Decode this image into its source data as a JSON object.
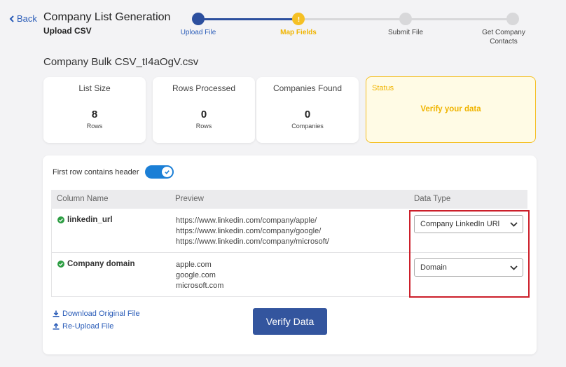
{
  "header": {
    "back_label": "Back",
    "title": "Company List Generation",
    "subtitle": "Upload CSV"
  },
  "stepper": {
    "steps": [
      {
        "label": "Upload File",
        "state": "done"
      },
      {
        "label": "Map Fields",
        "state": "current"
      },
      {
        "label": "Submit File",
        "state": "pending"
      },
      {
        "label": "Get Company Contacts",
        "state": "pending"
      }
    ],
    "colors": {
      "done": "#2c4f9e",
      "current": "#f5c024",
      "pending": "#d8d8da"
    }
  },
  "file": {
    "title": "Company Bulk CSV_tI4aOgV.csv"
  },
  "stats": [
    {
      "label": "List Size",
      "value": "8",
      "unit": "Rows"
    },
    {
      "label": "Rows Processed",
      "value": "0",
      "unit": "Rows"
    },
    {
      "label": "Companies Found",
      "value": "0",
      "unit": "Companies"
    }
  ],
  "status": {
    "label": "Status",
    "text": "Verify your data"
  },
  "mapping": {
    "header_toggle_label": "First row contains header",
    "header_toggle_on": true,
    "columns": {
      "name": "Column Name",
      "preview": "Preview",
      "type": "Data Type"
    },
    "rows": [
      {
        "name": "linkedin_url",
        "preview": [
          "https://www.linkedin.com/company/apple/",
          "https://www.linkedin.com/company/google/",
          "https://www.linkedin.com/company/microsoft/"
        ],
        "data_type": "Company LinkedIn URl"
      },
      {
        "name": "Company domain",
        "preview": [
          "apple.com",
          "google.com",
          "microsoft.com"
        ],
        "data_type": "Domain"
      }
    ]
  },
  "actions": {
    "download_label": "Download Original File",
    "reupload_label": "Re-Upload File",
    "verify_label": "Verify Data"
  },
  "colors": {
    "accent": "#33559e",
    "link": "#2a5cb8",
    "status": "#f0b400",
    "toggle": "#1b7fd6",
    "highlight": "#cc1f2a"
  }
}
